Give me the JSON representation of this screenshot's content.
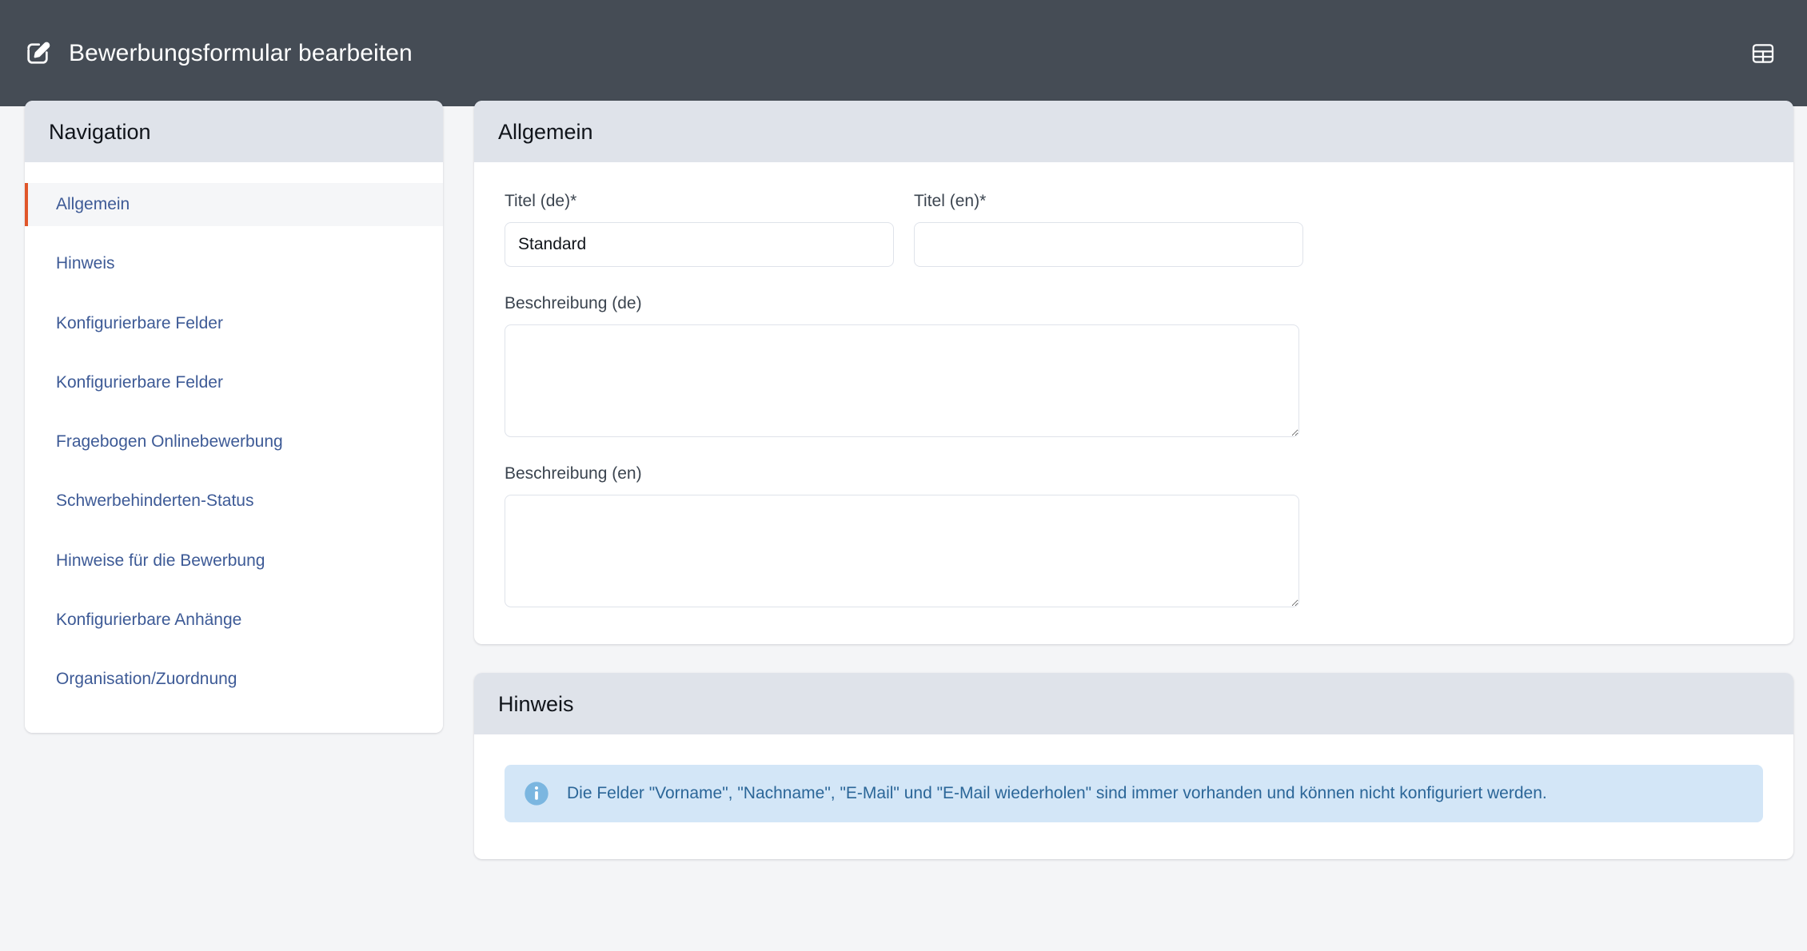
{
  "app_bar": {
    "title": "Bewerbungsformular bearbeiten",
    "edit_icon": "pencil-square-icon",
    "layout_icon": "table-layout-icon"
  },
  "navigation": {
    "title": "Navigation",
    "items": [
      {
        "label": "Allgemein",
        "active": true
      },
      {
        "label": "Hinweis",
        "active": false
      },
      {
        "label": "Konfigurierbare Felder",
        "active": false
      },
      {
        "label": "Konfigurierbare Felder",
        "active": false
      },
      {
        "label": "Fragebogen Onlinebewerbung",
        "active": false
      },
      {
        "label": "Schwerbehinderten-Status",
        "active": false
      },
      {
        "label": "Hinweise für die Bewerbung",
        "active": false
      },
      {
        "label": "Konfigurierbare Anhänge",
        "active": false
      },
      {
        "label": "Organisation/Zuordnung",
        "active": false
      }
    ]
  },
  "allgemein": {
    "title": "Allgemein",
    "titel_de": {
      "label": "Titel (de)*",
      "value": "Standard",
      "placeholder": ""
    },
    "titel_en": {
      "label": "Titel (en)*",
      "value": "",
      "placeholder": ""
    },
    "beschreibung_de": {
      "label": "Beschreibung (de)",
      "value": "",
      "placeholder": ""
    },
    "beschreibung_en": {
      "label": "Beschreibung (en)",
      "value": "",
      "placeholder": ""
    }
  },
  "hinweis": {
    "title": "Hinweis",
    "alert": {
      "icon": "info-circle-icon",
      "text": "Die Felder \"Vorname\", \"Nachname\", \"E-Mail\" und \"E-Mail wiederholen\" sind immer vorhanden und können nicht konfiguriert werden."
    }
  },
  "colors": {
    "app_bar": "#454c55",
    "page_background": "#f4f5f7",
    "card_header": "#dfe3ea",
    "accent_active": "#e0562a",
    "link": "#3d5a96",
    "alert_background": "#d3e6f7",
    "alert_text": "#2b6698"
  }
}
